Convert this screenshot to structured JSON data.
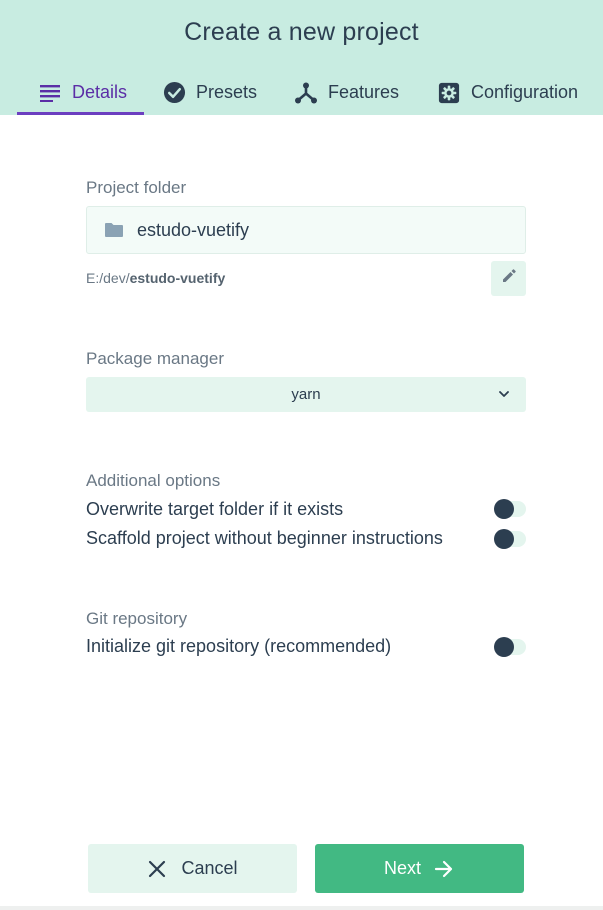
{
  "header": {
    "title": "Create a new project",
    "tabs": [
      {
        "label": "Details",
        "icon": "details-list-icon",
        "active": true
      },
      {
        "label": "Presets",
        "icon": "check-circle-icon",
        "active": false
      },
      {
        "label": "Features",
        "icon": "fork-icon",
        "active": false
      },
      {
        "label": "Configuration",
        "icon": "gear-icon",
        "active": false
      }
    ]
  },
  "project_folder": {
    "label": "Project folder",
    "value": "estudo-vuetify",
    "path_prefix": "E:/dev/",
    "path_name": "estudo-vuetify",
    "icon": "folder-icon",
    "edit_icon": "pencil-icon"
  },
  "package_manager": {
    "label": "Package manager",
    "selected": "yarn",
    "icon": "chevron-down-icon"
  },
  "additional_options": {
    "label": "Additional options",
    "items": [
      {
        "label": "Overwrite target folder if it exists",
        "enabled": false
      },
      {
        "label": "Scaffold project without beginner instructions",
        "enabled": false
      }
    ]
  },
  "git": {
    "label": "Git repository",
    "items": [
      {
        "label": "Initialize git repository (recommended)",
        "enabled": false
      }
    ]
  },
  "footer": {
    "cancel_label": "Cancel",
    "next_label": "Next",
    "cancel_icon": "close-icon",
    "next_icon": "arrow-right-icon"
  },
  "colors": {
    "header_bg": "#c8ece1",
    "accent": "#42b983",
    "active_tab": "#5b2ea6",
    "text": "#2c3e50",
    "muted": "#6a7885"
  }
}
